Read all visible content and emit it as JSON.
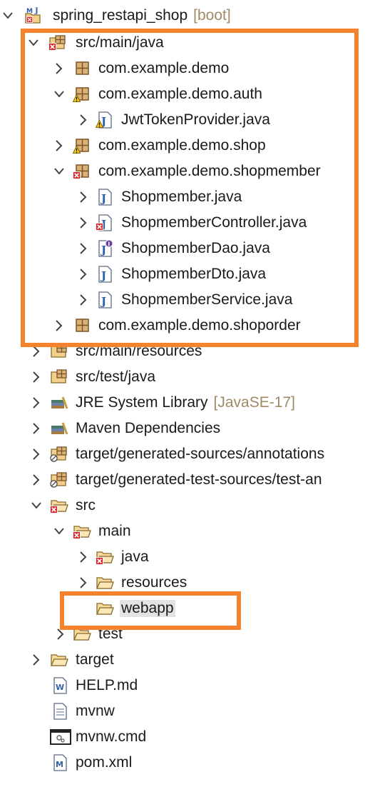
{
  "colors": {
    "highlight": "#f5822d",
    "decoration": "#a08a66",
    "selection": "#e3e3e3"
  },
  "tree": {
    "project": {
      "label": "spring_restapi_shop",
      "decoration": "[boot]",
      "icon": "maven-java-project-icon"
    },
    "src_main_java": {
      "label": "src/main/java",
      "icon": "source-folder-error-icon"
    },
    "pkg_demo": {
      "label": "com.example.demo",
      "icon": "package-icon"
    },
    "pkg_auth": {
      "label": "com.example.demo.auth",
      "icon": "package-warning-icon"
    },
    "jwt": {
      "label": "JwtTokenProvider.java",
      "icon": "java-file-warning-icon"
    },
    "pkg_shop": {
      "label": "com.example.demo.shop",
      "icon": "package-warning-icon"
    },
    "pkg_shopmember": {
      "label": "com.example.demo.shopmember",
      "icon": "package-error-icon"
    },
    "shopmember": {
      "label": "Shopmember.java",
      "icon": "java-file-icon"
    },
    "controller": {
      "label": "ShopmemberController.java",
      "icon": "java-file-error-icon"
    },
    "dao": {
      "label": "ShopmemberDao.java",
      "icon": "java-interface-icon"
    },
    "dto": {
      "label": "ShopmemberDto.java",
      "icon": "java-file-icon"
    },
    "service": {
      "label": "ShopmemberService.java",
      "icon": "java-file-icon"
    },
    "pkg_shoporder": {
      "label": "com.example.demo.shoporder",
      "icon": "package-icon"
    },
    "src_main_resources": {
      "label": "src/main/resources",
      "icon": "source-folder-icon"
    },
    "src_test_java": {
      "label": "src/test/java",
      "icon": "source-folder-icon"
    },
    "jre": {
      "label": "JRE System Library",
      "decoration": "[JavaSE-17]",
      "icon": "library-icon"
    },
    "maven": {
      "label": "Maven Dependencies",
      "icon": "library-icon"
    },
    "gen_sources": {
      "label": "target/generated-sources/annotations",
      "icon": "source-folder-optional-icon"
    },
    "gen_test": {
      "label": "target/generated-test-sources/test-an",
      "icon": "source-folder-optional-icon"
    },
    "src": {
      "label": "src",
      "icon": "folder-error-icon"
    },
    "main": {
      "label": "main",
      "icon": "folder-error-icon"
    },
    "java": {
      "label": "java",
      "icon": "folder-error-icon"
    },
    "resources": {
      "label": "resources",
      "icon": "folder-icon"
    },
    "webapp": {
      "label": "webapp",
      "icon": "folder-icon"
    },
    "test": {
      "label": "test",
      "icon": "folder-icon"
    },
    "target": {
      "label": "target",
      "icon": "folder-icon"
    },
    "help": {
      "label": "HELP.md",
      "icon": "word-file-icon"
    },
    "mvnw": {
      "label": "mvnw",
      "icon": "text-file-icon"
    },
    "mvnw_cmd": {
      "label": "mvnw.cmd",
      "icon": "cmd-file-icon"
    },
    "pom": {
      "label": "pom.xml",
      "icon": "maven-pom-icon"
    }
  }
}
